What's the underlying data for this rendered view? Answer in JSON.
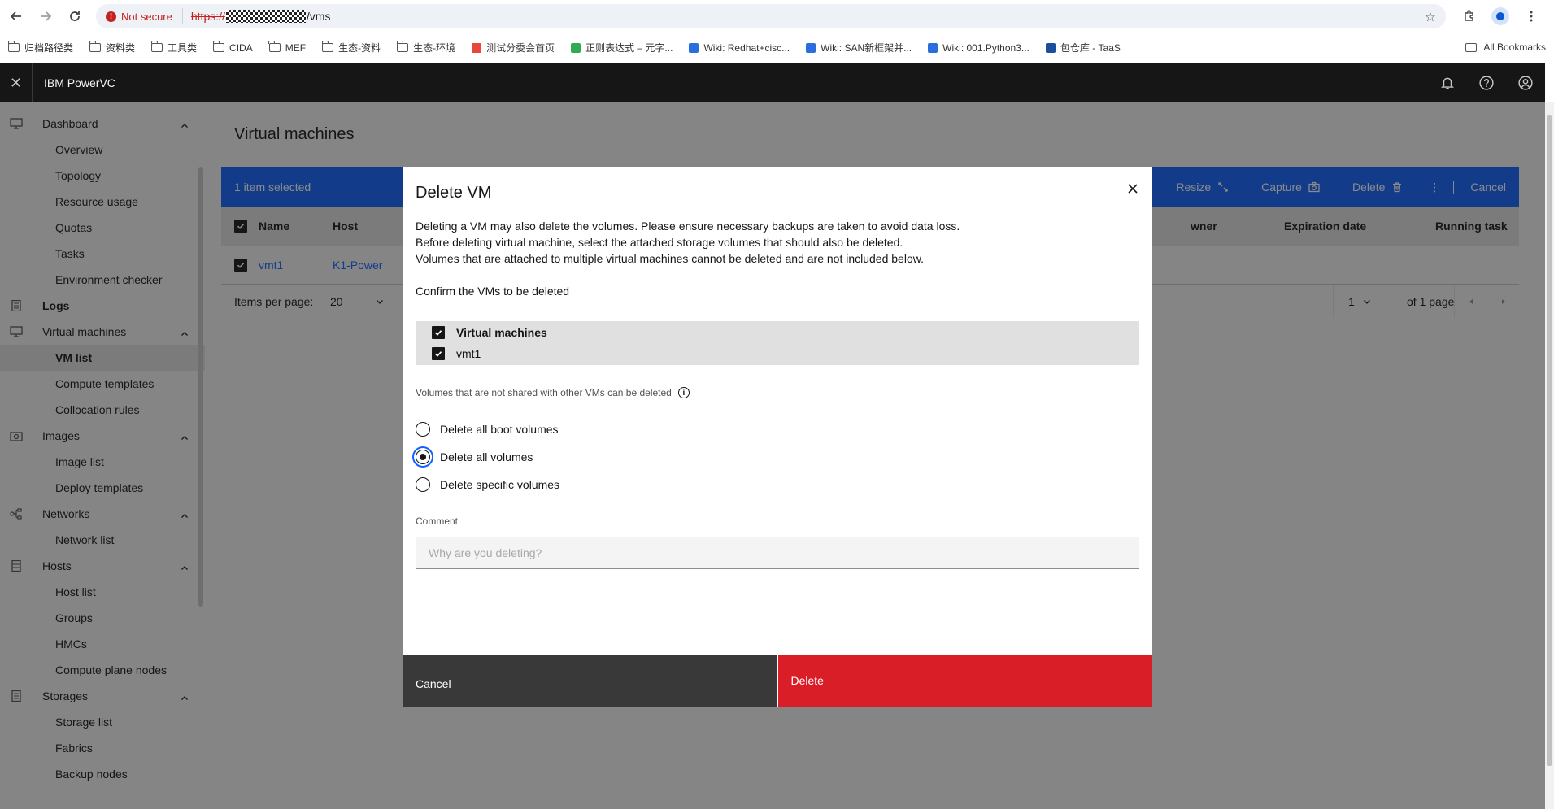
{
  "browser": {
    "security_label": "Not secure",
    "url_scheme": "https://",
    "url_path": "/vms",
    "bookmarks": [
      {
        "label": "归档路径类",
        "type": "folder"
      },
      {
        "label": "资料类",
        "type": "folder"
      },
      {
        "label": "工具类",
        "type": "folder"
      },
      {
        "label": "CIDA",
        "type": "folder"
      },
      {
        "label": "MEF",
        "type": "folder"
      },
      {
        "label": "生态-资料",
        "type": "folder"
      },
      {
        "label": "生态-环境",
        "type": "folder"
      },
      {
        "label": "测试分委会首页",
        "type": "site"
      },
      {
        "label": "正则表达式 – 元字...",
        "type": "site"
      },
      {
        "label": "Wiki: Redhat+cisc...",
        "type": "site"
      },
      {
        "label": "Wiki: SAN新框架并...",
        "type": "site"
      },
      {
        "label": "Wiki: 001.Python3...",
        "type": "site"
      },
      {
        "label": "包仓库 - TaaS",
        "type": "site"
      }
    ],
    "all_bookmarks_label": "All Bookmarks"
  },
  "app": {
    "title": "IBM PowerVC"
  },
  "sidebar": {
    "groups": [
      {
        "label": "Dashboard",
        "icon": "monitor-icon",
        "items": [
          "Overview",
          "Topology",
          "Resource usage",
          "Quotas",
          "Tasks",
          "Environment checker"
        ]
      },
      {
        "label": "Logs",
        "icon": "document-icon",
        "items": []
      },
      {
        "label": "Virtual machines",
        "icon": "monitor-icon",
        "items": [
          "VM list",
          "Compute templates",
          "Collocation rules"
        ]
      },
      {
        "label": "Images",
        "icon": "camera-icon",
        "items": [
          "Image list",
          "Deploy templates"
        ]
      },
      {
        "label": "Networks",
        "icon": "network-icon",
        "items": [
          "Network list"
        ]
      },
      {
        "label": "Hosts",
        "icon": "server-icon",
        "items": [
          "Host list",
          "Groups",
          "HMCs",
          "Compute plane nodes"
        ]
      },
      {
        "label": "Storages",
        "icon": "storage-icon",
        "items": [
          "Storage list",
          "Fabrics",
          "Backup nodes"
        ]
      }
    ],
    "active_item": "VM list"
  },
  "main": {
    "page_title": "Virtual machines",
    "selection_text": "1 item selected",
    "actions": {
      "resize": "Resize",
      "capture": "Capture",
      "delete": "Delete",
      "cancel": "Cancel"
    },
    "columns": {
      "name": "Name",
      "host": "Host",
      "owner": "wner",
      "expiration": "Expiration date",
      "running_task": "Running task"
    },
    "row": {
      "name": "vmt1",
      "host": "K1-Power"
    },
    "pager": {
      "items_per_page_label": "Items per page:",
      "items_per_page_value": "20",
      "page_value": "1",
      "page_total": "of 1 page"
    }
  },
  "modal": {
    "title": "Delete VM",
    "description_lines": [
      "Deleting a VM may also delete the volumes. Please ensure necessary backups are taken to avoid data loss.",
      "Before deleting virtual machine, select the attached storage volumes that should also be deleted.",
      "Volumes that are attached to multiple virtual machines cannot be deleted and are not included below."
    ],
    "confirm_label": "Confirm the VMs to be deleted",
    "vm_table_header": "Virtual machines",
    "vm_rows": [
      "vmt1"
    ],
    "volumes_label": "Volumes that are not shared with other VMs can be deleted",
    "radio_options": [
      {
        "label": "Delete all boot volumes",
        "checked": false
      },
      {
        "label": "Delete all volumes",
        "checked": true
      },
      {
        "label": "Delete specific volumes",
        "checked": false
      }
    ],
    "comment_label": "Comment",
    "comment_placeholder": "Why are you deleting?",
    "cancel_label": "Cancel",
    "delete_label": "Delete"
  },
  "colors": {
    "header_bg": "#161616",
    "accent_blue": "#0f62fe",
    "danger_red": "#da1e28",
    "secondary_button": "#393939"
  }
}
